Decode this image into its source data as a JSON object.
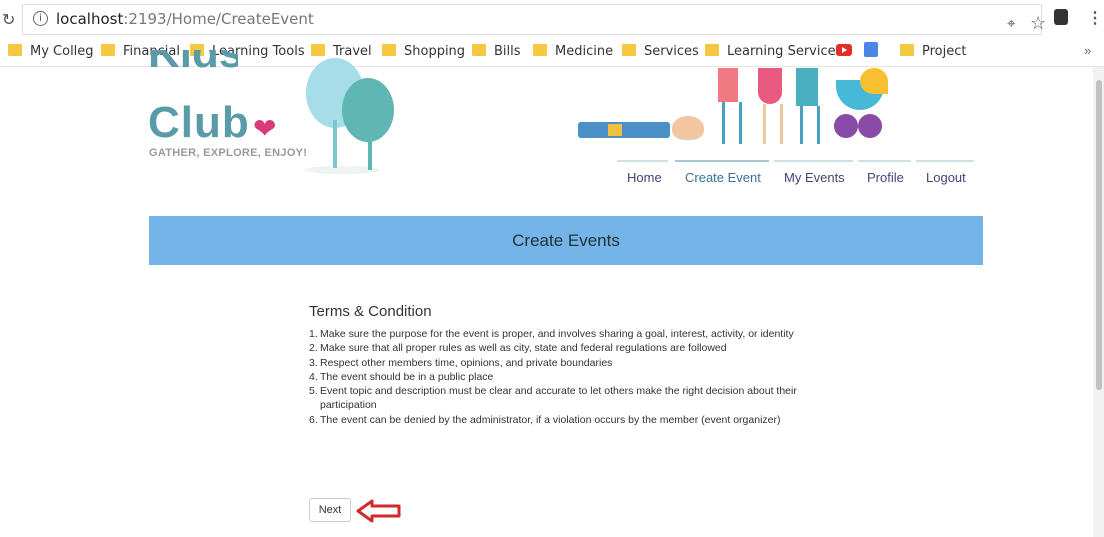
{
  "browser": {
    "url_host": "localhost",
    "url_path": ":2193/Home/CreateEvent",
    "icons": [
      "reload-icon",
      "info-icon",
      "zoom-icon",
      "star-icon",
      "extension-icon",
      "menu-icon"
    ]
  },
  "bookmarks": [
    "My Colleg",
    "Financial",
    "Learning Tools",
    "Travel",
    "Shopping",
    "Bills",
    "Medicine",
    "Services",
    "Learning Services",
    "Project"
  ],
  "bookmarks_overflow": "»",
  "site": {
    "logo_top": "Kids",
    "logo_club": "Club",
    "tagline": "GATHER, EXPLORE, ENJOY!"
  },
  "nav": {
    "items": [
      "Home",
      "Create Event",
      "My Events",
      "Profile",
      "Logout"
    ],
    "active": "Create Event"
  },
  "banner": {
    "title": "Create Events"
  },
  "terms": {
    "title": "Terms & Condition",
    "items": [
      {
        "num": "1.",
        "text": "Make sure the purpose for the event is proper, and involves sharing a goal, interest, activity, or identity"
      },
      {
        "num": "2.",
        "text": "Make sure that all proper rules as well as city, state and federal regulations are followed"
      },
      {
        "num": "3.",
        "text": "Respect other members time, opinions, and private boundaries"
      },
      {
        "num": "4.",
        "text": "The event should be in a public place"
      },
      {
        "num": "5.",
        "text": "Event topic and description must be clear and accurate to let others make the right decision about their participation"
      },
      {
        "num": "6.",
        "text": "The event can be denied by the administrator, if a violation occurs by the member (event organizer)"
      }
    ]
  },
  "next_button": {
    "label": "Next"
  },
  "colors": {
    "banner": "#74b4e8",
    "logo": "#5a9ba8",
    "arrow": "#d22a2a"
  }
}
